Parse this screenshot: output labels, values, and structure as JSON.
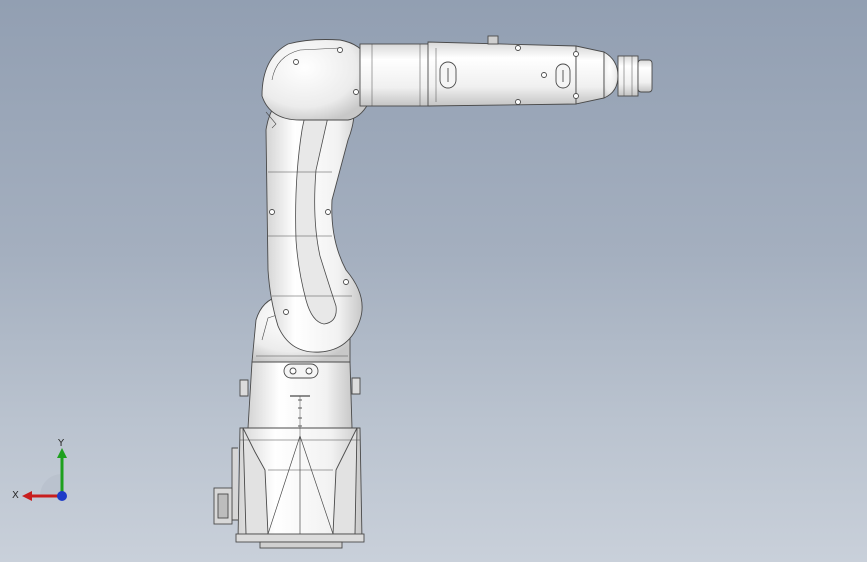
{
  "viewport": {
    "background_top": "#929fb2",
    "background_bottom": "#c9d0da"
  },
  "model": {
    "body_color": "#f1f1f1",
    "edge_color": "#4a4a4a",
    "shade_color": "#cfcfcf"
  },
  "triad": {
    "x_label": "X",
    "y_label": "Y",
    "x_color": "#c81e1e",
    "y_color": "#1ea01e",
    "z_color": "#1e3cc8"
  }
}
